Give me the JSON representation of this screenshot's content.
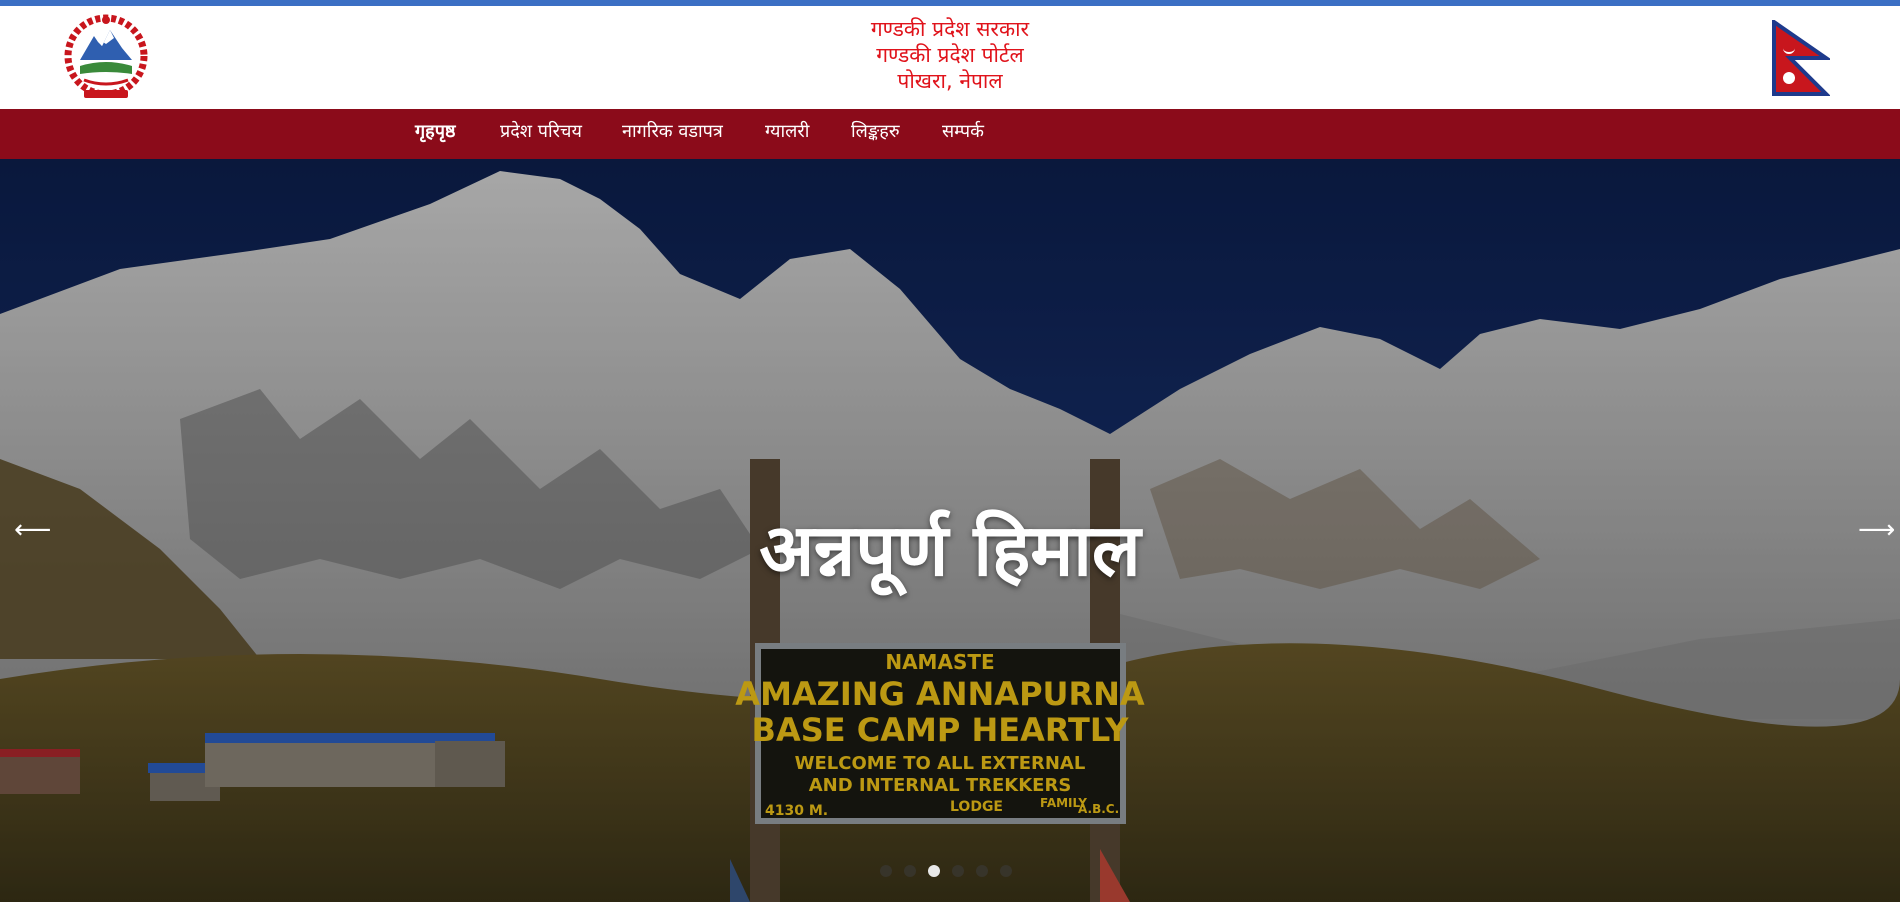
{
  "header": {
    "title_line1": "गण्डकी प्रदेश सरकार",
    "title_line2": "गण्डकी प्रदेश पोर्टल",
    "title_line3": "पोखरा, नेपाल",
    "emblem_icon": "nepal-emblem-icon",
    "flag_icon": "nepal-flag-icon"
  },
  "nav": {
    "items": [
      {
        "label": "गृहपृष्ठ",
        "active": true
      },
      {
        "label": "प्रदेश परिचय",
        "active": false
      },
      {
        "label": "नागरिक वडापत्र",
        "active": false
      },
      {
        "label": "ग्यालरी",
        "active": false
      },
      {
        "label": "लिङ्कहरु",
        "active": false
      },
      {
        "label": "सम्पर्क",
        "active": false
      }
    ]
  },
  "carousel": {
    "caption": "अन्नपूर्ण हिमाल",
    "prev_icon": "arrow-left-icon",
    "next_icon": "arrow-right-icon",
    "slide_count": 6,
    "active_slide": 3,
    "sign": {
      "line1": "NAMASTE",
      "line2": "AMAZING ANNAPURNA",
      "line3": "BASE CAMP HEARTLY",
      "line4": "WELCOME TO ALL EXTERNAL",
      "line5": "AND INTERNAL TREKKERS",
      "line6": "LODGE",
      "line7": "FAMILY",
      "line8": "A.B.C.",
      "line9": "4130 M."
    }
  },
  "colors": {
    "accent_bar": "#3b6fc4",
    "title_red": "#e0131b",
    "navbar_bg": "#8b0b1a"
  }
}
